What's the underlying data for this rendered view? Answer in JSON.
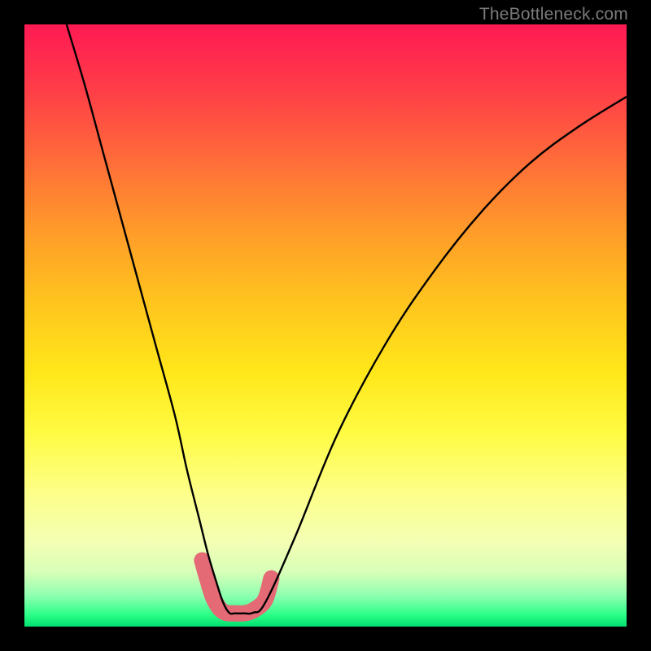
{
  "watermark": "TheBottleneck.com",
  "chart_data": {
    "type": "line",
    "title": "",
    "xlabel": "",
    "ylabel": "",
    "xlim": [
      0,
      100
    ],
    "ylim": [
      0,
      100
    ],
    "series": [
      {
        "name": "bottleneck-curve",
        "x": [
          7,
          10,
          13,
          16,
          19,
          22,
          25,
          27,
          29,
          30.5,
          32,
          33,
          34,
          35,
          36.5,
          38,
          40,
          45,
          52,
          60,
          68,
          76,
          84,
          92,
          100
        ],
        "y": [
          100,
          90,
          79,
          68,
          57,
          46,
          35,
          26,
          18,
          12,
          7,
          4,
          2.3,
          2.2,
          2.2,
          2.3,
          4,
          15,
          32,
          47,
          59,
          69,
          77,
          83,
          88
        ]
      },
      {
        "name": "highlight-band",
        "x": [
          29.5,
          30.5,
          31.5,
          33,
          35,
          37,
          38.5,
          40,
          41
        ],
        "y": [
          11,
          7.5,
          4.5,
          2.5,
          2.2,
          2.3,
          3,
          4.5,
          8
        ]
      }
    ],
    "colors": {
      "curve": "#000000",
      "highlight": "#e46a75"
    },
    "gradient_stops": [
      {
        "pos": 0,
        "color": "#ff1a53"
      },
      {
        "pos": 0.5,
        "color": "#ffe81a"
      },
      {
        "pos": 0.95,
        "color": "#8bffb0"
      },
      {
        "pos": 1.0,
        "color": "#00e070"
      }
    ]
  }
}
